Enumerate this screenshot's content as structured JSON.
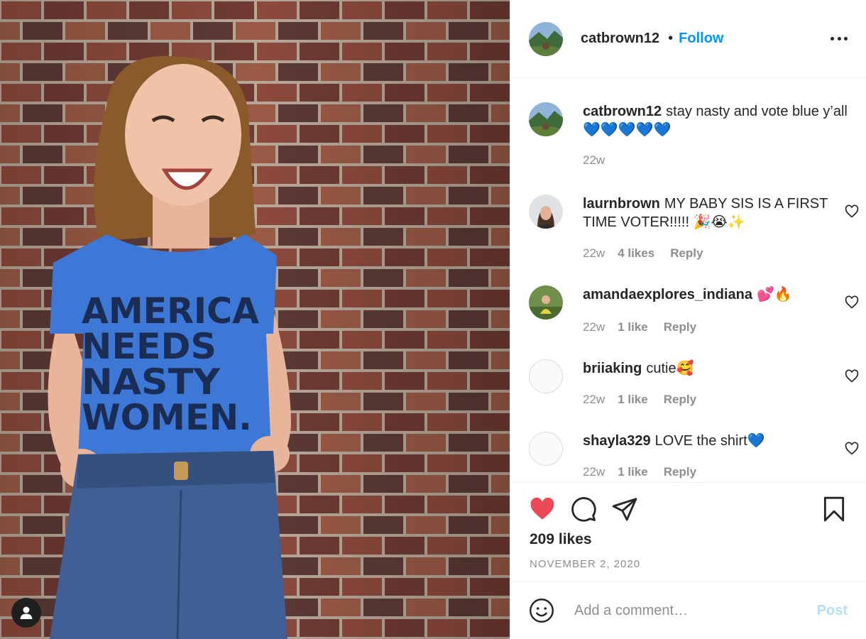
{
  "post": {
    "author": "catbrown12",
    "follow_label": "Follow",
    "separator": "•",
    "photo_text": [
      "AMERICA",
      "NEEDS",
      "NASTY",
      "WOMEN."
    ]
  },
  "caption": {
    "username": "catbrown12",
    "text": "stay nasty and vote blue y’all 💙💙💙💙💙",
    "time": "22w"
  },
  "comments": [
    {
      "username": "laurnbrown",
      "text": "MY BABY SIS IS A FIRST TIME VOTER!!!!! 🎉😭✨",
      "time": "22w",
      "likes": "4 likes",
      "reply": "Reply"
    },
    {
      "username": "amandaexplores_indiana",
      "text": "💕🔥",
      "time": "22w",
      "likes": "1 like",
      "reply": "Reply"
    },
    {
      "username": "briiaking",
      "text": "cutie🥰",
      "time": "22w",
      "likes": "1 like",
      "reply": "Reply"
    },
    {
      "username": "shayla329",
      "text": "LOVE the shirt💙",
      "time": "22w",
      "likes": "1 like",
      "reply": "Reply"
    }
  ],
  "stats": {
    "likes": "209 likes",
    "date": "NOVEMBER 2, 2020"
  },
  "composer": {
    "placeholder": "Add a comment…",
    "post_label": "Post"
  },
  "icons": {
    "like": "heart-filled-icon",
    "comment": "comment-bubble-icon",
    "share": "paper-plane-icon",
    "save": "bookmark-icon",
    "emoji": "smiley-icon",
    "more": "more-options-icon",
    "user_tag": "user-tag-icon"
  },
  "colors": {
    "accent": "#0095f6",
    "like_red": "#ed4956",
    "shirt_blue": "#3d78d6",
    "brick": "#8a4a3a"
  }
}
